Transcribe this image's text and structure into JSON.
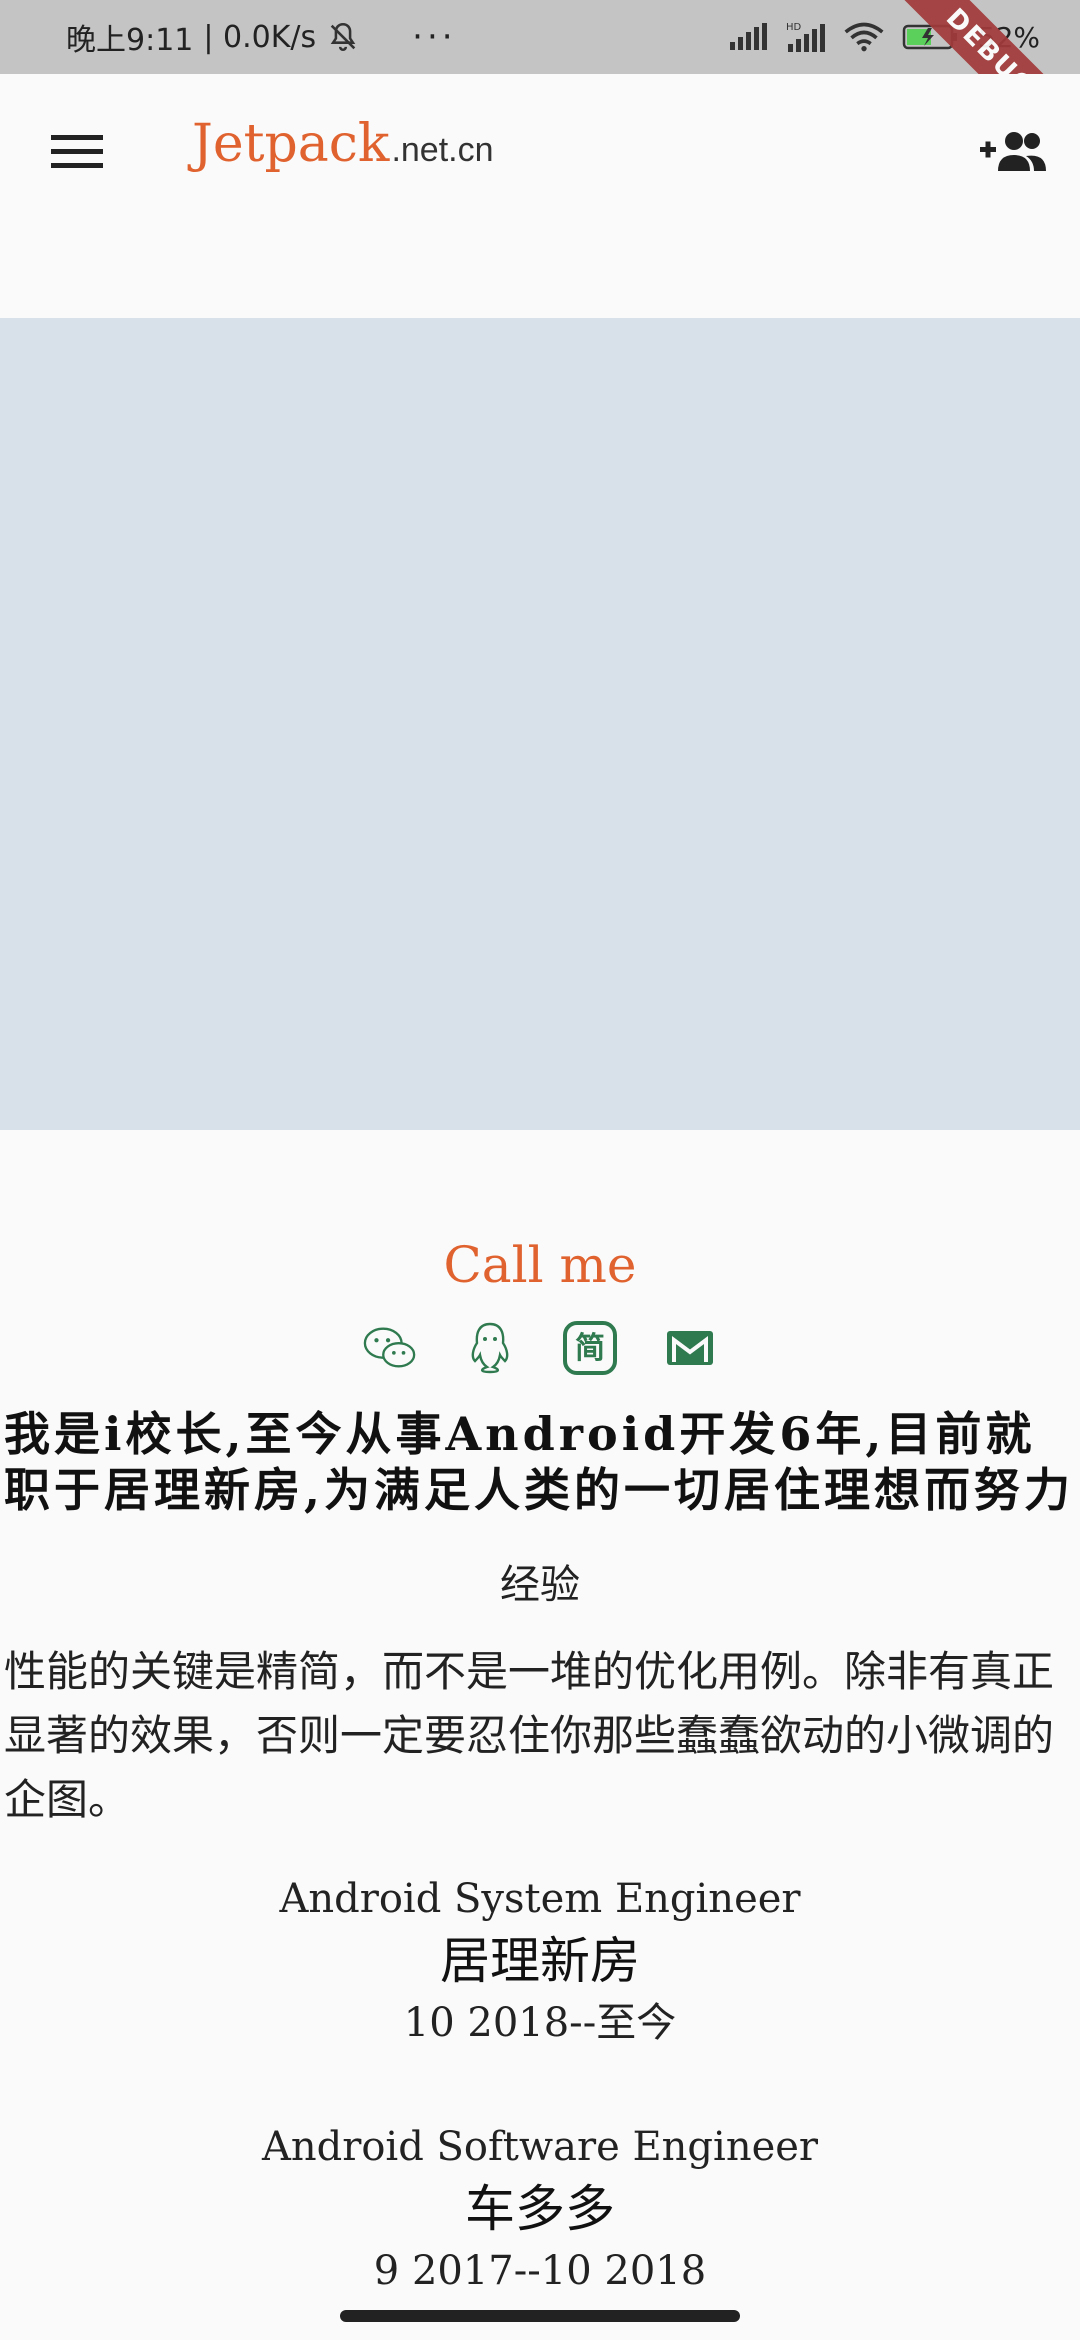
{
  "status_bar": {
    "time": "晚上9:11",
    "net_speed": "| 0.0K/s",
    "more": "···",
    "battery": "52%",
    "debug_label": "DEBUG"
  },
  "app_bar": {
    "brand_main": "Jetpack",
    "brand_domain": ".net.cn",
    "icons": {
      "menu": "menu-icon",
      "add_user": "person-add-icon"
    }
  },
  "profile": {
    "call_me": "Call me",
    "contact_icons": [
      "wechat-icon",
      "qq-icon",
      "jianshu-icon",
      "gmail-icon"
    ],
    "intro": "我是i校长,至今从事Android开发6年,目前就职于居理新房,为满足人类的一切居住理想而努力",
    "experience_title": "经验",
    "quote": "性能的关键是精简，而不是一堆的优化用例。除非有真正显著的效果，否则一定要忍住你那些蠢蠢欲动的小微调的企图。",
    "jobs": [
      {
        "role": "Android System Engineer",
        "company": "居理新房",
        "period": "10 2018--至今"
      },
      {
        "role": "Android Software Engineer",
        "company": "车多多",
        "period": "9 2017--10 2018"
      }
    ]
  },
  "colors": {
    "accent": "#e0622f",
    "banner": "#d8e1ea",
    "icon_green": "#2f7a4f"
  }
}
